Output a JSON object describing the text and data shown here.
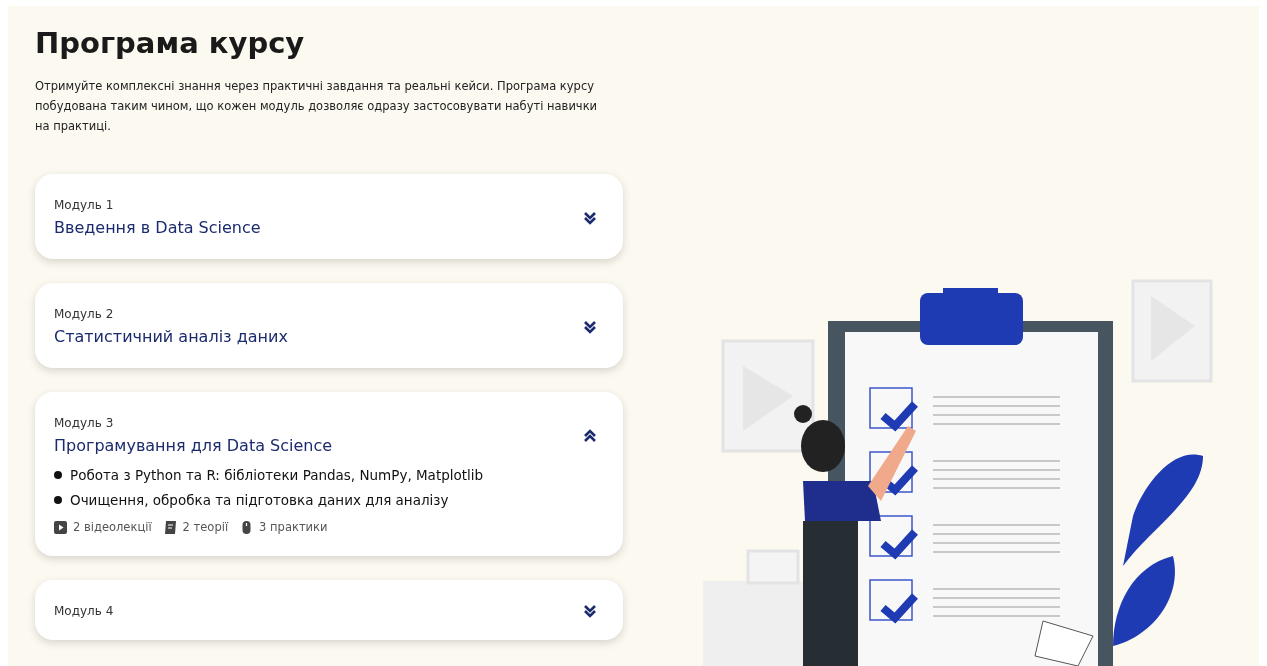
{
  "heading": "Програма курсу",
  "intro": "Отримуйте комплексні знання через практичні завдання та реальні кейси. Програма курсу побудована таким чином, що кожен модуль дозволяє одразу застосовувати набуті навички на практиці.",
  "modules": [
    {
      "label": "Модуль 1",
      "title": "Введення в Data Science",
      "expanded": false
    },
    {
      "label": "Модуль 2",
      "title": "Статистичний аналіз даних",
      "expanded": false
    },
    {
      "label": "Модуль 3",
      "title": "Програмування для Data Science",
      "expanded": true,
      "topics": [
        "Робота з Python та R: бібліотеки Pandas, NumPy, Matplotlib",
        "Очищення, обробка та підготовка даних для аналізу"
      ],
      "stats": [
        {
          "kind": "video",
          "text": "2 відеолекції"
        },
        {
          "kind": "theory",
          "text": "2 теорії"
        },
        {
          "kind": "practice",
          "text": "3 практики"
        }
      ]
    },
    {
      "label": "Модуль 4",
      "expanded": false
    }
  ]
}
